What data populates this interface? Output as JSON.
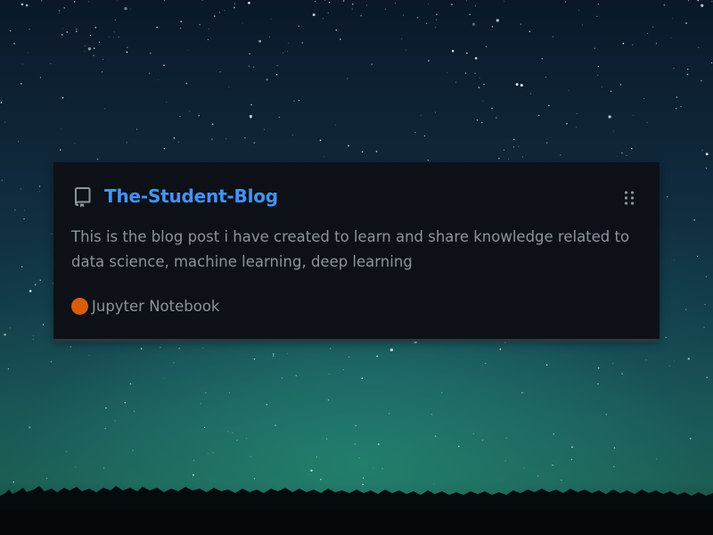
{
  "card": {
    "title": "The-Student-Blog",
    "description": "This is the blog post i have created to learn and share knowledge related to data science, machine learning, deep learning",
    "language": {
      "name": "Jupyter Notebook",
      "color": "#DA5B0B"
    }
  },
  "icons": {
    "repo": "repo-icon",
    "drag": "grabber-icon"
  },
  "colors": {
    "card_background": "#0d1117",
    "title": "#4493f8",
    "text": "#8b949e"
  }
}
